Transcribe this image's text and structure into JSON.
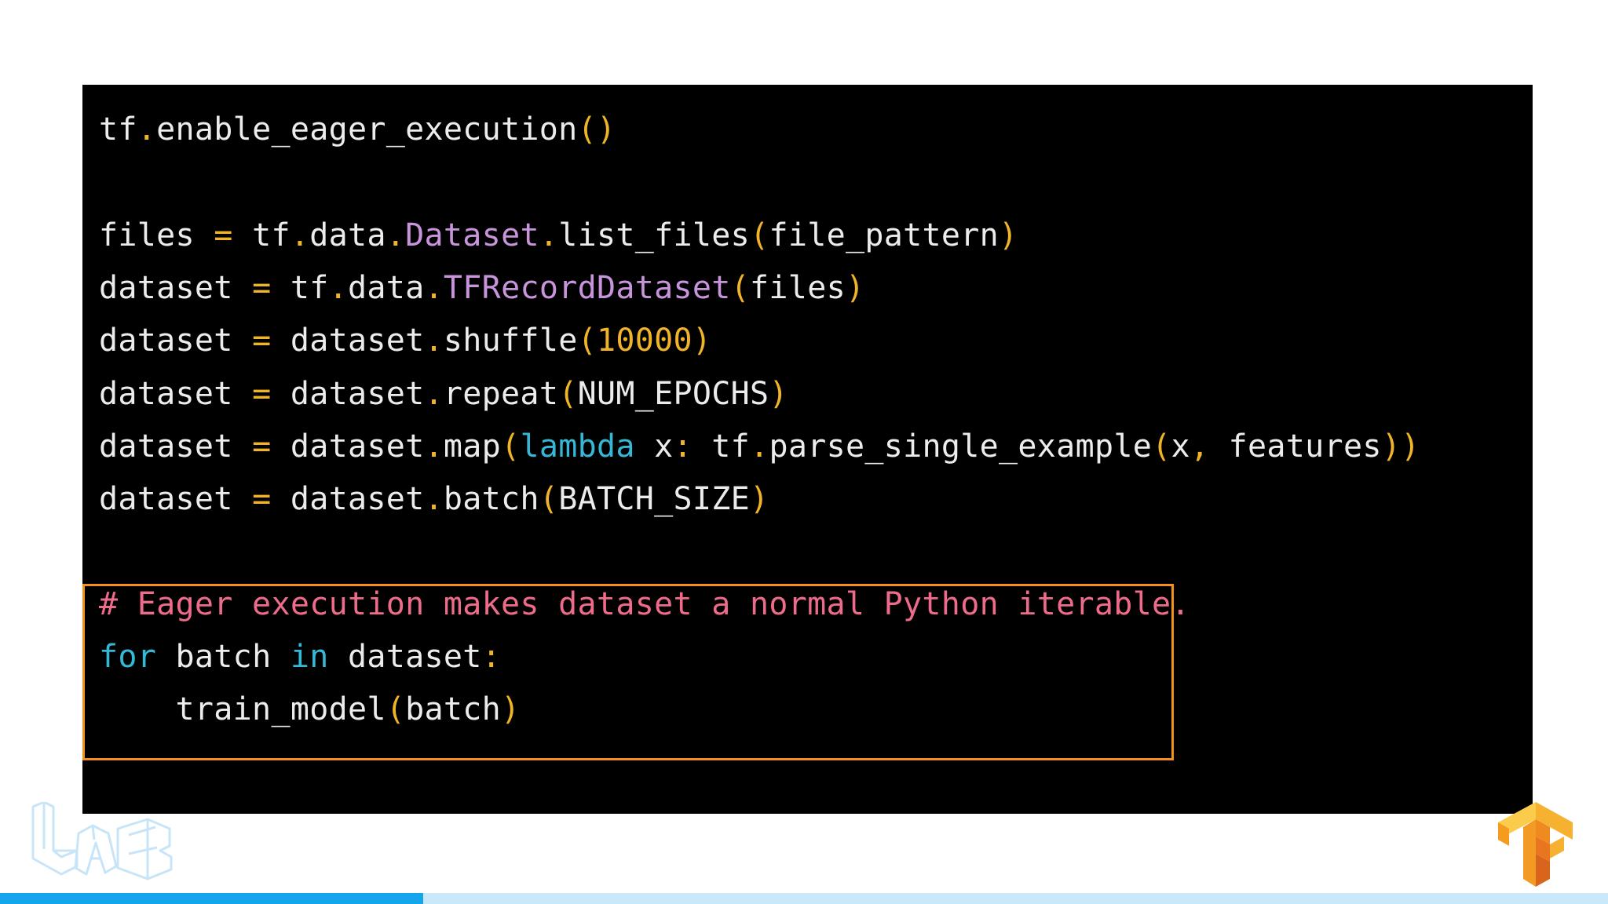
{
  "colors": {
    "panel_background": "#000000",
    "text": "#ececec",
    "punctuation": "#f0b429",
    "class_name": "#c895dc",
    "keyword": "#34b8d6",
    "comment": "#ee6b8a",
    "highlight_border": "#f5901e",
    "progress_fill": "#14a5ec",
    "progress_track": "#c9e9fb"
  },
  "code": {
    "lines": [
      [
        {
          "t": "tf"
        },
        {
          "t": ".",
          "s": "p"
        },
        {
          "t": "enable_eager_execution"
        },
        {
          "t": "()",
          "s": "p"
        }
      ],
      [],
      [
        {
          "t": "files "
        },
        {
          "t": "=",
          "s": "p"
        },
        {
          "t": " tf"
        },
        {
          "t": ".",
          "s": "p"
        },
        {
          "t": "data"
        },
        {
          "t": ".",
          "s": "p"
        },
        {
          "t": "Dataset",
          "s": "c"
        },
        {
          "t": ".",
          "s": "p"
        },
        {
          "t": "list_files"
        },
        {
          "t": "(",
          "s": "p"
        },
        {
          "t": "file_pattern"
        },
        {
          "t": ")",
          "s": "p"
        }
      ],
      [
        {
          "t": "dataset "
        },
        {
          "t": "=",
          "s": "p"
        },
        {
          "t": " tf"
        },
        {
          "t": ".",
          "s": "p"
        },
        {
          "t": "data"
        },
        {
          "t": ".",
          "s": "p"
        },
        {
          "t": "TFRecordDataset",
          "s": "c"
        },
        {
          "t": "(",
          "s": "p"
        },
        {
          "t": "files"
        },
        {
          "t": ")",
          "s": "p"
        }
      ],
      [
        {
          "t": "dataset "
        },
        {
          "t": "=",
          "s": "p"
        },
        {
          "t": " dataset"
        },
        {
          "t": ".",
          "s": "p"
        },
        {
          "t": "shuffle"
        },
        {
          "t": "(",
          "s": "p"
        },
        {
          "t": "10000",
          "s": "n"
        },
        {
          "t": ")",
          "s": "p"
        }
      ],
      [
        {
          "t": "dataset "
        },
        {
          "t": "=",
          "s": "p"
        },
        {
          "t": " dataset"
        },
        {
          "t": ".",
          "s": "p"
        },
        {
          "t": "repeat"
        },
        {
          "t": "(",
          "s": "p"
        },
        {
          "t": "NUM_EPOCHS"
        },
        {
          "t": ")",
          "s": "p"
        }
      ],
      [
        {
          "t": "dataset "
        },
        {
          "t": "=",
          "s": "p"
        },
        {
          "t": " dataset"
        },
        {
          "t": ".",
          "s": "p"
        },
        {
          "t": "map"
        },
        {
          "t": "(",
          "s": "p"
        },
        {
          "t": "lambda",
          "s": "k"
        },
        {
          "t": " x"
        },
        {
          "t": ":",
          "s": "p"
        },
        {
          "t": " tf"
        },
        {
          "t": ".",
          "s": "p"
        },
        {
          "t": "parse_single_example"
        },
        {
          "t": "(",
          "s": "p"
        },
        {
          "t": "x"
        },
        {
          "t": ",",
          "s": "p"
        },
        {
          "t": " features"
        },
        {
          "t": "))",
          "s": "p"
        }
      ],
      [
        {
          "t": "dataset "
        },
        {
          "t": "=",
          "s": "p"
        },
        {
          "t": " dataset"
        },
        {
          "t": ".",
          "s": "p"
        },
        {
          "t": "batch"
        },
        {
          "t": "(",
          "s": "p"
        },
        {
          "t": "BATCH_SIZE"
        },
        {
          "t": ")",
          "s": "p"
        }
      ],
      [],
      [
        {
          "t": "# Eager execution makes dataset a normal Python iterable.",
          "s": "m"
        }
      ],
      [
        {
          "t": "for",
          "s": "k"
        },
        {
          "t": " batch "
        },
        {
          "t": "in",
          "s": "k"
        },
        {
          "t": " dataset"
        },
        {
          "t": ":",
          "s": "p"
        }
      ],
      [
        {
          "t": "    train_model"
        },
        {
          "t": "(",
          "s": "p"
        },
        {
          "t": "batch"
        },
        {
          "t": ")",
          "s": "p"
        }
      ]
    ]
  },
  "logos": {
    "left": {
      "icon": "ml-lab-logo-icon"
    },
    "right": {
      "icon": "tensorflow-logo-icon"
    }
  },
  "progress": {
    "fraction": 0.263
  }
}
